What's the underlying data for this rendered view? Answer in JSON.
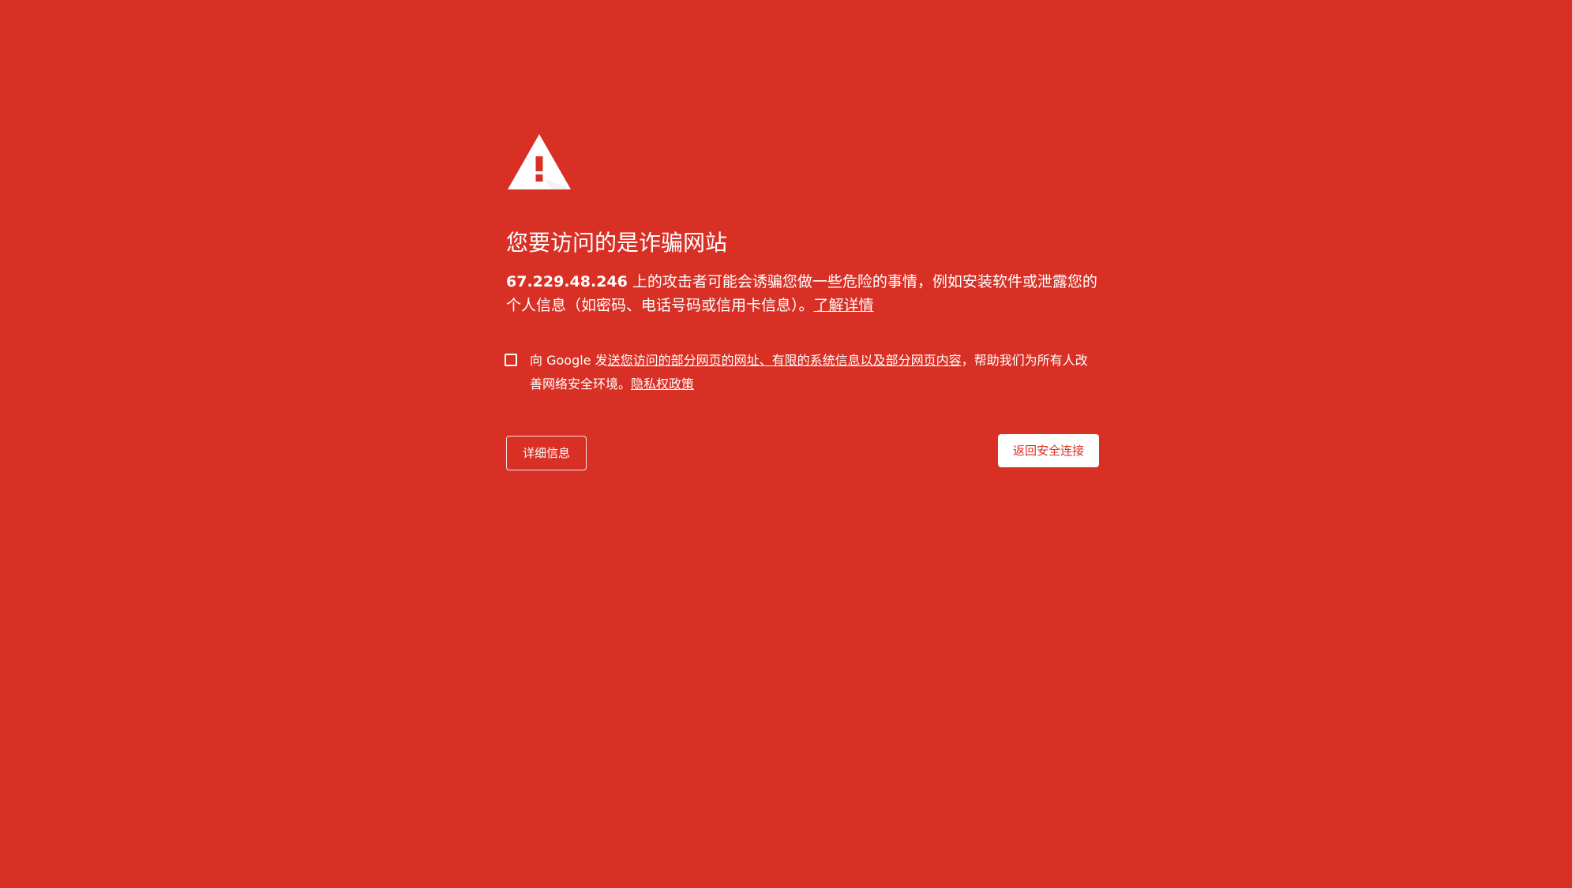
{
  "colors": {
    "background": "#d93025",
    "foreground": "#ffffff",
    "primary_button_text": "#d93025"
  },
  "icon": {
    "name": "warning-triangle-icon"
  },
  "interstitial": {
    "title": "您要访问的是诈骗网站",
    "host": "67.229.48.246",
    "message": " 上的攻击者可能会诱骗您做一些危险的事情，例如安装软件或泄露您的个人信息（如密码、电话号码或信用卡信息）。",
    "learn_more": "了解详情"
  },
  "optin": {
    "checked": false,
    "prefix": "向 Google 发",
    "link": "送您访问的部分网页的网址、有限的系统信息以及部分网页内容",
    "suffix": "，帮助我们为所有人改善网络安全环境。",
    "privacy_link": "隐私权政策"
  },
  "buttons": {
    "details": "详细信息",
    "back_to_safety": "返回安全连接"
  }
}
